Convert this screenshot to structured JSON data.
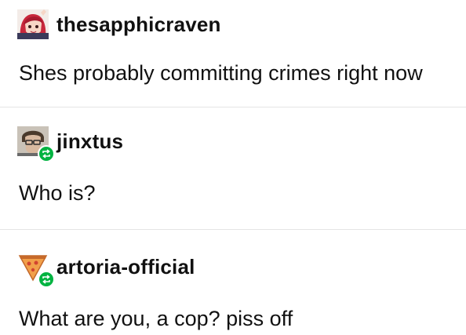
{
  "thread": {
    "posts": [
      {
        "username": "thesapphicraven",
        "text": "Shes probably committing crimes right now",
        "avatar_icon": "anime-girl-avatar",
        "reblog": false
      },
      {
        "username": "jinxtus",
        "text": "Who is?",
        "avatar_icon": "person-photo-avatar",
        "reblog": true
      },
      {
        "username": "artoria-official",
        "text": "What are you, a cop? piss off",
        "avatar_icon": "pizza-slice-avatar",
        "reblog": true
      }
    ],
    "colors": {
      "reblog_badge": "#00b341",
      "divider": "#e4e4e4",
      "text": "#111111"
    }
  }
}
